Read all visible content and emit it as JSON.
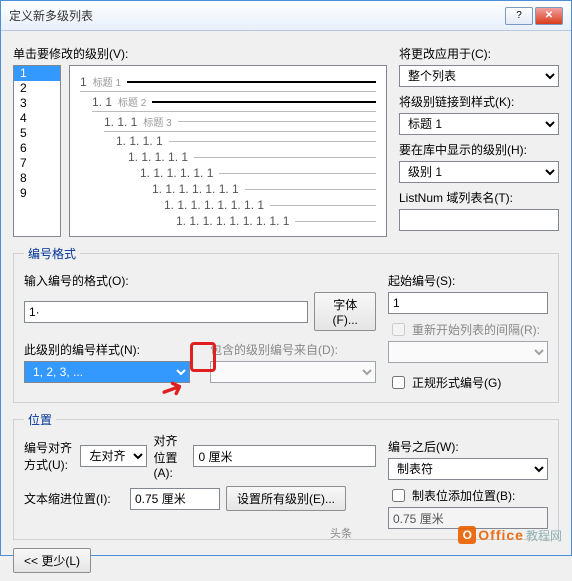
{
  "title": "定义新多级列表",
  "label_click_level": "单击要修改的级别(V):",
  "levels": [
    "1",
    "2",
    "3",
    "4",
    "5",
    "6",
    "7",
    "8",
    "9"
  ],
  "level_selected": "1",
  "preview_lines": [
    {
      "indent": 0,
      "num": "1",
      "txt": "标题 1",
      "bold": true
    },
    {
      "indent": 1,
      "num": "1. 1",
      "txt": "标题 2",
      "bold": true
    },
    {
      "indent": 2,
      "num": "1. 1. 1",
      "txt": "标题 3",
      "bold": false
    },
    {
      "indent": 3,
      "num": "1. 1. 1. 1",
      "txt": "",
      "bold": false
    },
    {
      "indent": 4,
      "num": "1. 1. 1. 1. 1",
      "txt": "",
      "bold": false
    },
    {
      "indent": 5,
      "num": "1. 1. 1. 1. 1. 1",
      "txt": "",
      "bold": false
    },
    {
      "indent": 6,
      "num": "1. 1. 1. 1. 1. 1. 1",
      "txt": "",
      "bold": false
    },
    {
      "indent": 7,
      "num": "1. 1. 1. 1. 1. 1. 1. 1",
      "txt": "",
      "bold": false
    },
    {
      "indent": 8,
      "num": "1. 1. 1. 1. 1. 1. 1. 1. 1",
      "txt": "",
      "bold": false
    }
  ],
  "right": {
    "apply_to_label": "将更改应用于(C):",
    "apply_to_value": "整个列表",
    "link_style_label": "将级别链接到样式(K):",
    "link_style_value": "标题 1",
    "show_in_gallery_label": "要在库中显示的级别(H):",
    "show_in_gallery_value": "级别 1",
    "listnum_label": "ListNum 域列表名(T):",
    "listnum_value": ""
  },
  "fmt": {
    "legend": "编号格式",
    "format_label": "输入编号的格式(O):",
    "format_value": "1·",
    "font_btn": "字体(F)...",
    "style_label": "此级别的编号样式(N):",
    "style_value": "1, 2, 3, ...",
    "include_label": "包含的级别编号来自(D):",
    "include_value": "",
    "start_at_label": "起始编号(S):",
    "start_at_value": "1",
    "restart_label": "重新开始列表的间隔(R):",
    "restart_value": "",
    "legal_label": "正规形式编号(G)"
  },
  "pos": {
    "legend": "位置",
    "align_label": "编号对齐方式(U):",
    "align_value": "左对齐",
    "align_at_label": "对齐位置(A):",
    "align_at_value": "0 厘米",
    "indent_label": "文本缩进位置(I):",
    "indent_value": "0.75 厘米",
    "set_all_btn": "设置所有级别(E)...",
    "follow_label": "编号之后(W):",
    "follow_value": "制表符",
    "tab_add_label": "制表位添加位置(B):",
    "tab_add_value": "0.75 厘米"
  },
  "less_btn": "<< 更少(L)",
  "wm_head": "头条",
  "wm_office": "Office",
  "wm_tut": "教程网"
}
